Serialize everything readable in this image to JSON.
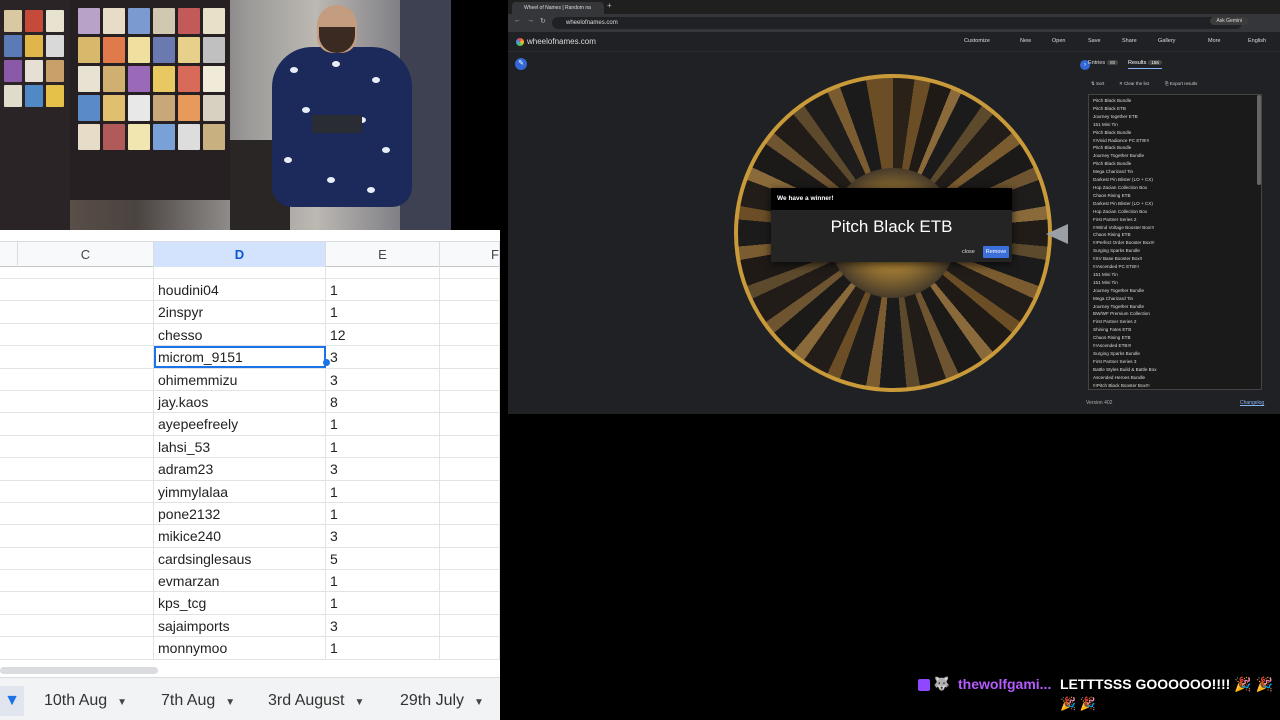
{
  "spreadsheet": {
    "columns": [
      "C",
      "D",
      "E",
      "F"
    ],
    "selected_column": "D",
    "rows": [
      {
        "name": "",
        "count": ""
      },
      {
        "name": "houdini04",
        "count": "1"
      },
      {
        "name": "2inspyr",
        "count": "1"
      },
      {
        "name": "chesso",
        "count": "12"
      },
      {
        "name": "microm_9151",
        "count": "3"
      },
      {
        "name": "ohimemmizu",
        "count": "3"
      },
      {
        "name": "jay.kaos",
        "count": "8"
      },
      {
        "name": "ayepeefreely",
        "count": "1"
      },
      {
        "name": "lahsi_53",
        "count": "1"
      },
      {
        "name": "adram23",
        "count": "3"
      },
      {
        "name": "yimmylalaa",
        "count": "1"
      },
      {
        "name": "pone2132",
        "count": "1"
      },
      {
        "name": "mikice240",
        "count": "3"
      },
      {
        "name": "cardsinglesaus",
        "count": "5"
      },
      {
        "name": "evmarzan",
        "count": "1"
      },
      {
        "name": "kps_tcg",
        "count": "1"
      },
      {
        "name": "sajaimports",
        "count": "3"
      },
      {
        "name": "monnymoo",
        "count": "1"
      }
    ],
    "sheet_tabs": [
      "10th Aug",
      "7th Aug",
      "3rd August",
      "29th July"
    ]
  },
  "browser": {
    "tab_title": "Wheel of Names | Random na",
    "url": "wheelofnames.com",
    "ask_label": "Ask Gemini",
    "site_name": "wheelofnames.com",
    "menu": [
      "Customize",
      "New",
      "Open",
      "Save",
      "Share",
      "Gallery",
      "More",
      "English"
    ],
    "dialog": {
      "heading": "We have a winner!",
      "winner": "Pitch Black ETB",
      "close_label": "close",
      "remove_label": "Remove"
    },
    "panel": {
      "entries_label": "Entries",
      "entries_count": "80",
      "results_label": "Results",
      "results_count": "156",
      "sort_label": "Sort",
      "clear_label": "Clear the list",
      "export_label": "Export results",
      "results": [
        "Pitch Black Bundle",
        "Pitch Black ETB",
        "Journey together ETB",
        "151 Mini Tin",
        "Pitch Black Bundle",
        "!!!Vivid Radiance PC ETB!!!",
        "Pitch Black Bundle",
        "Journey Together Bundle",
        "Pitch Black Bundle",
        "Mega Charizard Tin",
        "Darkest Pin Blister (LO + CX)",
        "Hop Zacian Collection Box",
        "Chaos Rising ETB",
        "Darkest Pin Blister (LO + CX)",
        "Hop Zacian Collection Box",
        "First Partner Series 2",
        "!!!Wind Voltage Booster Box!!!",
        "Chaos Rising ETB",
        "!!!Perfect Order Booster Box!!!",
        "Surging Sparks Bundle",
        "!!SV Base Booster Box!!",
        "!!!Ascended PC ETB!!!",
        "151 Mini Tin",
        "151 Mini Tin",
        "Journey Together Bundle",
        "Mega Charizard Tin",
        "Journey Together Bundle",
        "BW/WF Premium Collection",
        "First Partner Series 2",
        "Shining Fates ETB",
        "Chaos Rising ETB",
        "!!!Ascended ETB!!!",
        "Surging Sparks Bundle",
        "First Partner Series 3",
        "Battle Styles Build & Battle Box",
        "Ascended Heroes Bundle",
        "!!!Pitch Black Booster Box!!!",
        "First Partner Series"
      ],
      "version": "Version 402",
      "changelog": "Changelog"
    }
  },
  "chat": {
    "username": "thewolfgami...",
    "message": "LETTTSSS GOOOOOO!!!! 🎉 🎉",
    "emotes_line2": "🎉 🎉"
  },
  "colors": {
    "selection_blue": "#1a73e8",
    "remove_button": "#3b6fd9",
    "chat_username": "#b65cff",
    "twitch_purple": "#9146ff"
  }
}
